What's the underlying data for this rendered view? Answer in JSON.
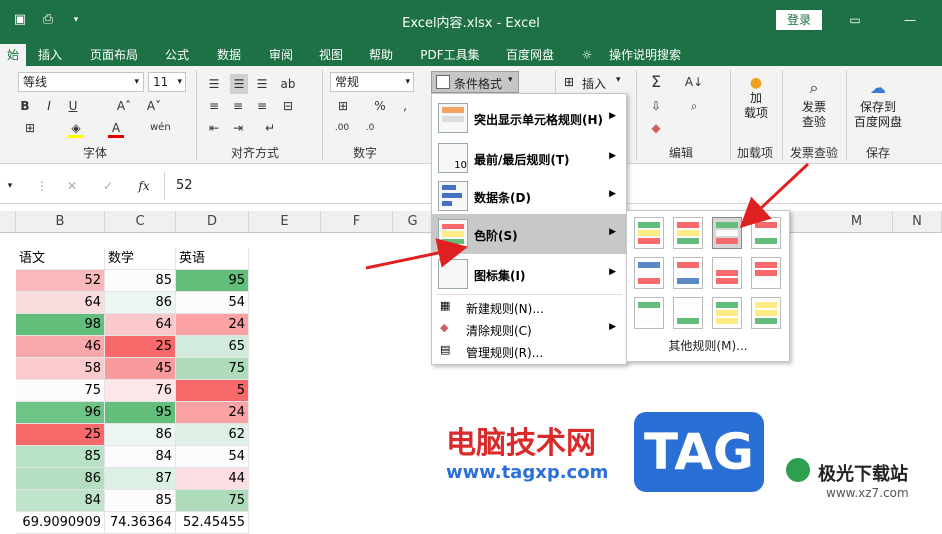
{
  "title": "Excel内容.xlsx  -  Excel",
  "login_label": "登录",
  "tabs": [
    "始",
    "插入",
    "页面布局",
    "公式",
    "数据",
    "审阅",
    "视图",
    "帮助",
    "PDF工具集",
    "百度网盘",
    "操作说明搜索"
  ],
  "ribbon": {
    "font_name": "等线",
    "font_size": "11",
    "number_format": "常规",
    "cond_format_label": "条件格式",
    "insert_label": "插入",
    "groups": {
      "font": "字体",
      "align": "对齐方式",
      "number": "数字",
      "edit": "编辑",
      "addins": "加载项",
      "invoice": "发票查验",
      "save": "保存"
    },
    "big_buttons": {
      "addin": [
        "加",
        "载项"
      ],
      "invoice": [
        "发票",
        "查验"
      ],
      "save": [
        "保存到",
        "百度网盘"
      ]
    }
  },
  "formula_bar": {
    "value": "52",
    "fx": "fx"
  },
  "columns": [
    "B",
    "C",
    "D",
    "E",
    "F",
    "G",
    "M",
    "N"
  ],
  "headers": [
    "语文",
    "数学",
    "英语"
  ],
  "rows": [
    [
      52,
      85,
      95
    ],
    [
      64,
      86,
      54
    ],
    [
      98,
      64,
      24
    ],
    [
      46,
      25,
      65
    ],
    [
      58,
      45,
      75
    ],
    [
      75,
      76,
      5
    ],
    [
      96,
      95,
      24
    ],
    [
      25,
      86,
      62
    ],
    [
      85,
      84,
      54
    ],
    [
      86,
      87,
      44
    ],
    [
      84,
      85,
      75
    ]
  ],
  "averages": [
    "69.9090909",
    "74.36364",
    "52.45455"
  ],
  "menu": {
    "items": [
      {
        "label": "突出显示单元格规则(H)",
        "arrow": true
      },
      {
        "label": "最前/最后规则(T)",
        "arrow": true
      },
      {
        "label": "数据条(D)",
        "arrow": true
      },
      {
        "label": "色阶(S)",
        "arrow": true
      },
      {
        "label": "图标集(I)",
        "arrow": true
      }
    ],
    "small_items": [
      {
        "label": "新建规则(N)...",
        "arrow": false
      },
      {
        "label": "清除规则(C)",
        "arrow": true
      },
      {
        "label": "管理规则(R)...",
        "arrow": false
      }
    ],
    "icon10": "10"
  },
  "submenu": {
    "more_label": "其他规则(M)..."
  },
  "watermark": {
    "text1": "电脑技术网",
    "text2": "www.tagxp.com",
    "tag": "TAG",
    "site": "极光下载站",
    "url": "www.xz7.com"
  },
  "colors": {
    "green": "#63be7b",
    "red": "#f8696b",
    "excel_green": "#1e7145"
  }
}
